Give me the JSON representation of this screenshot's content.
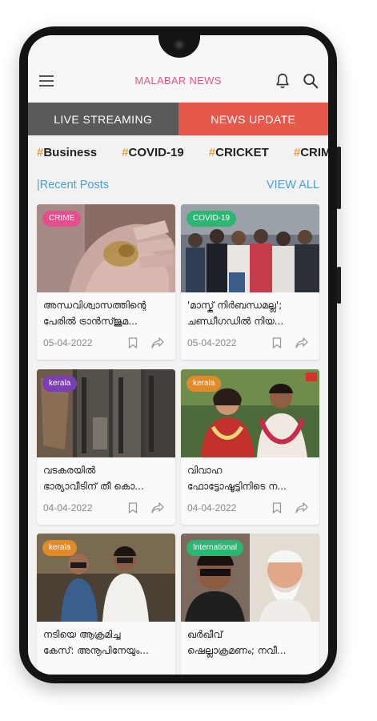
{
  "app": {
    "title": "MALABAR NEWS",
    "title_color": "#e2588b"
  },
  "tabs": [
    {
      "label": "LIVE STREAMING",
      "color": "#5a5a5a"
    },
    {
      "label": "NEWS UPDATE",
      "color": "#e6584a"
    }
  ],
  "hashtags": [
    {
      "hash": "#",
      "text": "Business"
    },
    {
      "hash": "#",
      "text": "COVID-19"
    },
    {
      "hash": "#",
      "text": "CRICKET"
    },
    {
      "hash": "#",
      "text": "CRIME"
    }
  ],
  "section": {
    "title": "|Recent Posts",
    "view_all": "VIEW ALL"
  },
  "posts": [
    {
      "badge": "CRIME",
      "badge_color": "#e44f8c",
      "line1": "അന്ധവിശ്വാസത്തിന്റെ",
      "line2": "പേരിൽ ട്രാൻസ്ജുമ...",
      "date": "05-04-2022",
      "image": "hand-photo"
    },
    {
      "badge": "COVID-19",
      "badge_color": "#2bb673",
      "line1": "'മാസ്ക് നിർബന്ധമല്ല';",
      "line2": "ചണ്ഡീഗഡിൽ നിയ...",
      "date": "05-04-2022",
      "image": "crowd-photo"
    },
    {
      "badge": "kerala",
      "badge_color": "#7b3fb3",
      "line1": "വടകരയിൽ",
      "line2": "ഭാര്യാവീടിന് തീ കൊ...",
      "date": "04-04-2022",
      "image": "burnt-house-photo"
    },
    {
      "badge": "kerala",
      "badge_color": "#e08a2a",
      "line1": "വിവാഹ",
      "line2": "ഫോട്ടോഷൂട്ടിനിടെ ന...",
      "date": "04-04-2022",
      "image": "wedding-couple-photo"
    },
    {
      "badge": "kerala",
      "badge_color": "#e08a2a",
      "line1": "നടിയെ ആക്രമിച്ച",
      "line2": "കേസ്: അനൂപിനേയും...",
      "date": "",
      "image": "two-men-photo"
    },
    {
      "badge": "International",
      "badge_color": "#2bb673",
      "line1": "ഖർഖീവ്",
      "line2": "ഷെല്ലാക്രമണം; നവീ...",
      "date": "",
      "image": "portraits-photo"
    }
  ]
}
